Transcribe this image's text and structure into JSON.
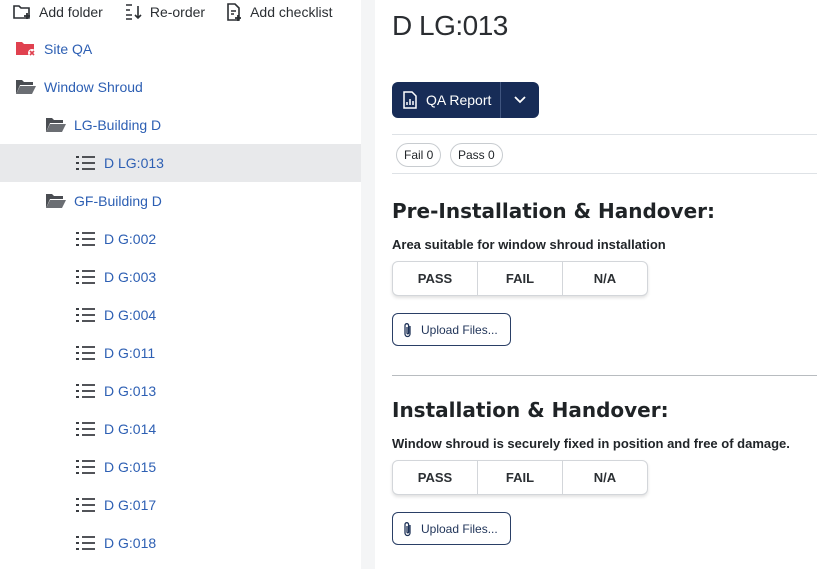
{
  "toolbar": {
    "add_folder": "Add folder",
    "reorder": "Re-order",
    "add_checklist": "Add checklist"
  },
  "tree": [
    {
      "label": "Site QA",
      "icon": "folder-error-icon",
      "level": 0
    },
    {
      "label": "Window Shroud",
      "icon": "folder-open-icon",
      "level": 0
    },
    {
      "label": "LG-Building D",
      "icon": "folder-open-icon",
      "level": 1
    },
    {
      "label": "D LG:013",
      "icon": "checklist-icon",
      "level": 2,
      "selected": true
    },
    {
      "label": "GF-Building D",
      "icon": "folder-open-icon",
      "level": 1
    },
    {
      "label": "D G:002",
      "icon": "checklist-icon",
      "level": 2
    },
    {
      "label": "D G:003",
      "icon": "checklist-icon",
      "level": 2
    },
    {
      "label": "D G:004",
      "icon": "checklist-icon",
      "level": 2
    },
    {
      "label": "D G:011",
      "icon": "checklist-icon",
      "level": 2
    },
    {
      "label": "D G:013",
      "icon": "checklist-icon",
      "level": 2
    },
    {
      "label": "D G:014",
      "icon": "checklist-icon",
      "level": 2
    },
    {
      "label": "D G:015",
      "icon": "checklist-icon",
      "level": 2
    },
    {
      "label": "D G:017",
      "icon": "checklist-icon",
      "level": 2
    },
    {
      "label": "D G:018",
      "icon": "checklist-icon",
      "level": 2
    }
  ],
  "detail": {
    "title": "D LG:013",
    "report_button": "QA Report",
    "counts": {
      "fail_label": "Fail 0",
      "pass_label": "Pass 0"
    },
    "sections": [
      {
        "title": "Pre-Installation & Handover:",
        "question": "Area suitable for window shroud installation",
        "choices": [
          "PASS",
          "FAIL",
          "N/A"
        ],
        "upload_label": "Upload Files..."
      },
      {
        "title": "Installation & Handover:",
        "question": "Window shroud is securely fixed in position and free of damage.",
        "choices": [
          "PASS",
          "FAIL",
          "N/A"
        ],
        "upload_label": "Upload Files..."
      }
    ]
  },
  "colors": {
    "link_blue": "#2d5fb3",
    "navy_button": "#172c57",
    "selected_row": "#e8e9eb",
    "error_red": "#e0414f"
  }
}
